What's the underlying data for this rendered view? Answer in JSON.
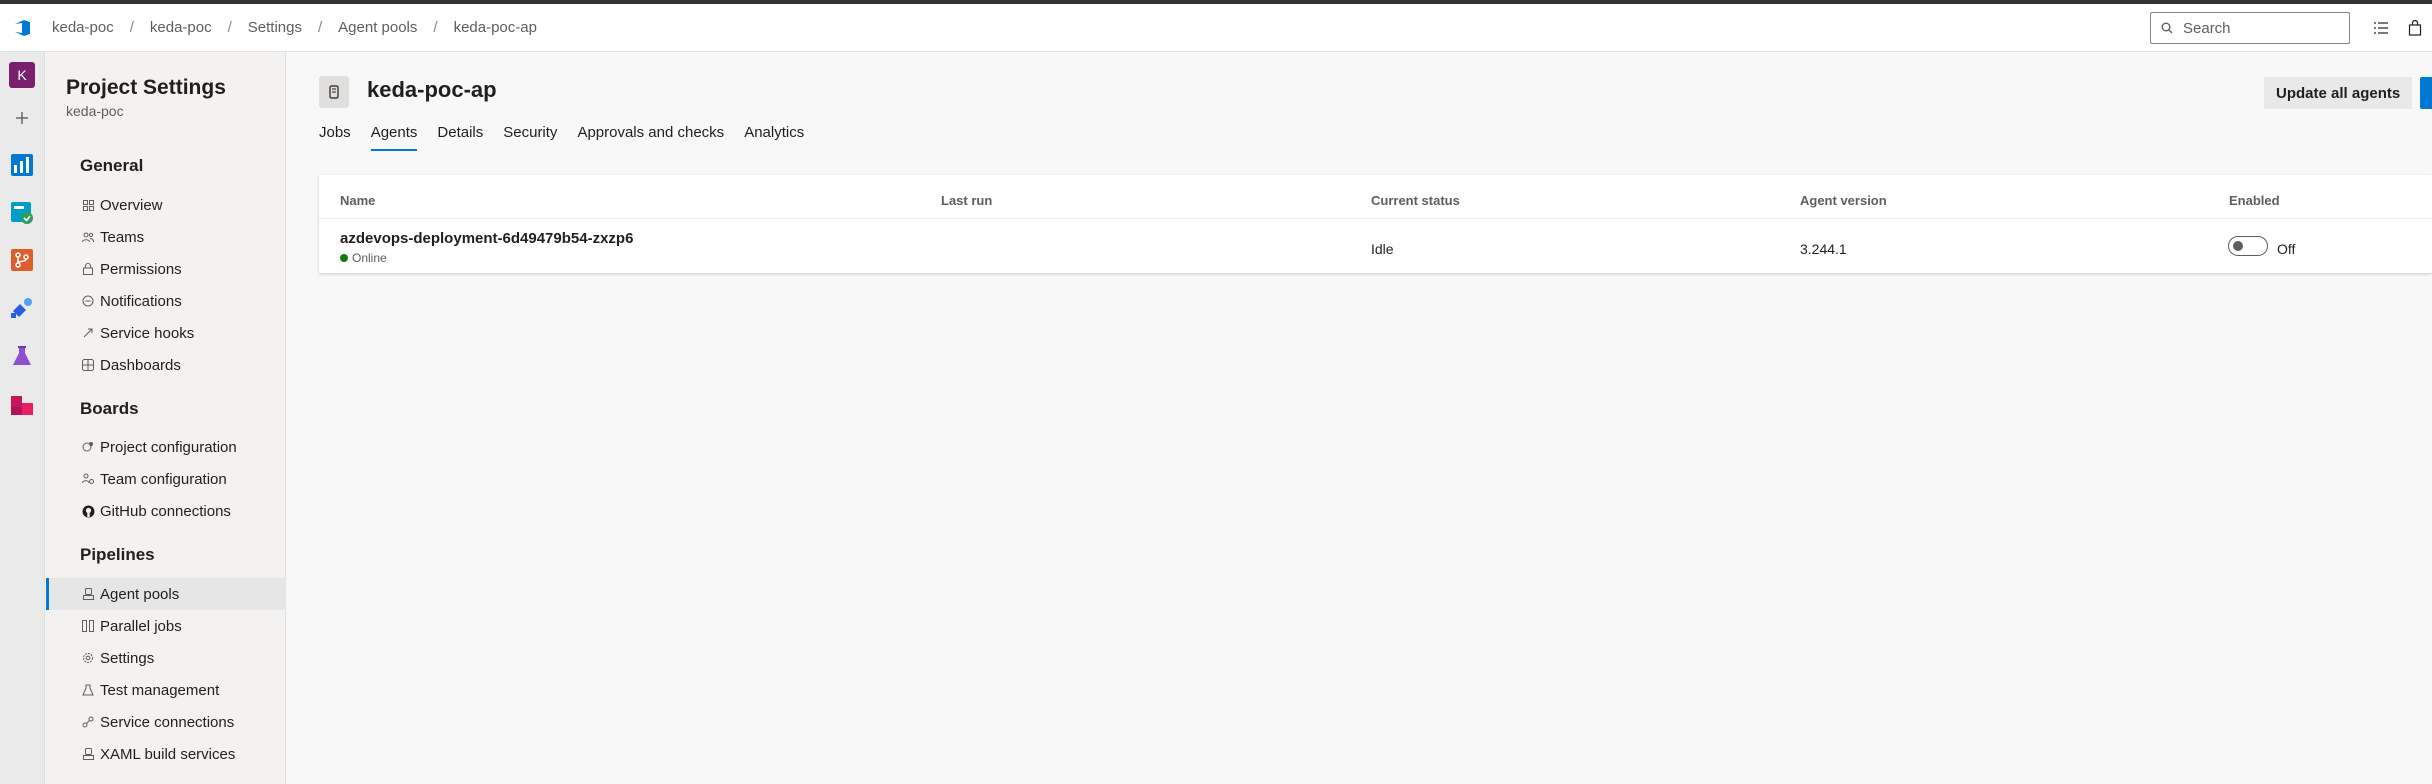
{
  "breadcrumb": [
    "keda-poc",
    "keda-poc",
    "Settings",
    "Agent pools",
    "keda-poc-ap"
  ],
  "search": {
    "placeholder": "Search"
  },
  "leftrail": {
    "avatar_letter": "K",
    "icons": [
      "azure-devops-logo",
      "plus-icon",
      "boards-icon",
      "test-plans-check-icon",
      "repos-icon",
      "pipelines-icon",
      "test-flask-icon",
      "artifacts-icon"
    ]
  },
  "sidebar": {
    "title": "Project Settings",
    "subtitle": "keda-poc",
    "sections": [
      {
        "header": "General",
        "items": [
          "Overview",
          "Teams",
          "Permissions",
          "Notifications",
          "Service hooks",
          "Dashboards"
        ]
      },
      {
        "header": "Boards",
        "items": [
          "Project configuration",
          "Team configuration",
          "GitHub connections"
        ]
      },
      {
        "header": "Pipelines",
        "items": [
          "Agent pools",
          "Parallel jobs",
          "Settings",
          "Test management",
          "Service connections",
          "XAML build services"
        ]
      }
    ],
    "active_item": "Agent pools"
  },
  "main": {
    "pool_title": "keda-poc-ap",
    "update_button": "Update all agents",
    "tabs": [
      "Jobs",
      "Agents",
      "Details",
      "Security",
      "Approvals and checks",
      "Analytics"
    ],
    "active_tab": "Agents"
  },
  "table": {
    "headers": [
      "Name",
      "Last run",
      "Current status",
      "Agent version",
      "Enabled"
    ],
    "rows": [
      {
        "name": "azdevops-deployment-6d49479b54-zxzp6",
        "online_status": "Online",
        "last_run": "",
        "current_status": "Idle",
        "agent_version": "3.244.1",
        "enabled_label": "Off"
      }
    ]
  },
  "colors": {
    "accent": "#0078d4",
    "online": "#107c10",
    "avatar": "#7a1f6e"
  }
}
